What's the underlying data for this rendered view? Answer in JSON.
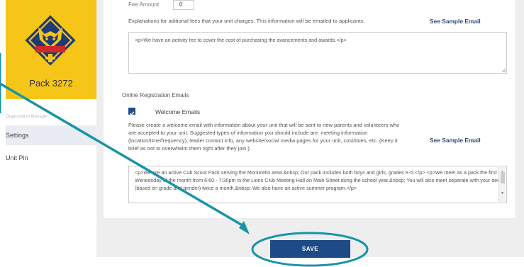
{
  "sidebar": {
    "pack_name": "Pack 3272",
    "org_label": "Organization Manager",
    "items": [
      {
        "label": "Settings",
        "active": true
      },
      {
        "label": "Unit Pin",
        "active": false
      }
    ]
  },
  "fees": {
    "amount_label": "Fee Amount",
    "amount_value": "0",
    "explanation": "Explanations for aditional fees that your unit charges. This information will be emailed to applicants.",
    "see_sample": "See Sample Email",
    "text": "<p>We have an activity fee to cover the cost of purchasing the avancements and awards.</p>"
  },
  "registration_emails": {
    "section_label": "Online Registration Emails",
    "welcome_label": "Welcome Emails",
    "welcome_checked": true,
    "description": "Please create a welcome email with information about your unit that will be sent to new parents and volunteers who are accepted to your unit. Suggested types of information you should include are: meeting information (location/time/frequency), leader contact info, any website/social media pages for your unit, cost/dues, etc. (Keep it brief as not to overwhelm them right after they join.)",
    "see_sample": "See Sample Email",
    "welcome_text": "<p>We are an active Cub Scout Pack serving the Monitcello area.&nbsp; Our pack includes both boys and girls, grades K-5.</p> <p>We meet as a pack the first Wenedsday of the month from 6:60 - 7:30pm in the Lions Club Meeting Hall on Main Street durig the school year.&nbsp; You will also meet separate with your den (based on grade and gender) twice a month.&nbsp; We also have an active summer program.</p>"
  },
  "actions": {
    "save_label": "SAVE"
  },
  "colors": {
    "brand_yellow": "#f5c518",
    "primary_blue": "#1e4a86",
    "annotation_teal": "#1a93a8"
  }
}
